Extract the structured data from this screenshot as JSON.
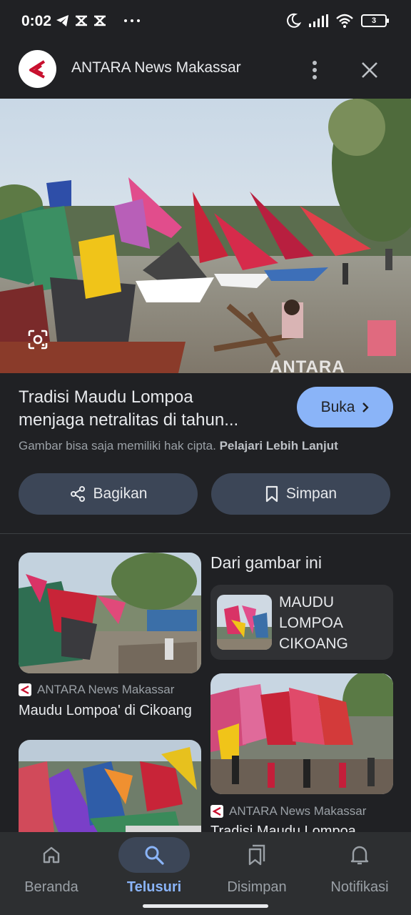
{
  "status_bar": {
    "time": "0:02",
    "battery": "3",
    "icons": [
      "telegram-icon",
      "capcut-icon",
      "capcut-icon",
      "more-dots-icon",
      "moon-icon",
      "signal-icon",
      "wifi-icon",
      "battery-icon"
    ]
  },
  "header": {
    "site_name": "ANTARA News Makassar",
    "more_icon": "more-vert-icon",
    "close_icon": "close-icon"
  },
  "hero": {
    "watermark": "ANTARA",
    "lens_icon": "google-lens-icon"
  },
  "article": {
    "title_line1": "Tradisi Maudu Lompoa",
    "title_line2": "menjaga netralitas di tahun...",
    "open_label": "Buka",
    "copyright_text": "Gambar bisa saja memiliki hak cipta.",
    "learn_more": "Pelajari Lebih Lanjut"
  },
  "actions": {
    "share_label": "Bagikan",
    "save_label": "Simpan"
  },
  "results": {
    "from_image_heading": "Dari gambar ini",
    "entity_name": "MAUDU LOMPOA CIKOANG",
    "items": [
      {
        "source": "ANTARA News Makassar",
        "title": "Maudu Lompoa' di Cikoang"
      },
      {
        "source": "ANTARA News Makassar",
        "title": "Tradisi Maudu Lompoa"
      }
    ]
  },
  "bottom_nav": [
    {
      "label": "Beranda",
      "icon": "home-icon",
      "active": false
    },
    {
      "label": "Telusuri",
      "icon": "search-icon",
      "active": true
    },
    {
      "label": "Disimpan",
      "icon": "collections-icon",
      "active": false
    },
    {
      "label": "Notifikasi",
      "icon": "bell-icon",
      "active": false
    }
  ],
  "colors": {
    "background": "#202124",
    "accent": "#8ab4f8",
    "button": "#3c4657",
    "nav_background": "#2d2f31"
  }
}
